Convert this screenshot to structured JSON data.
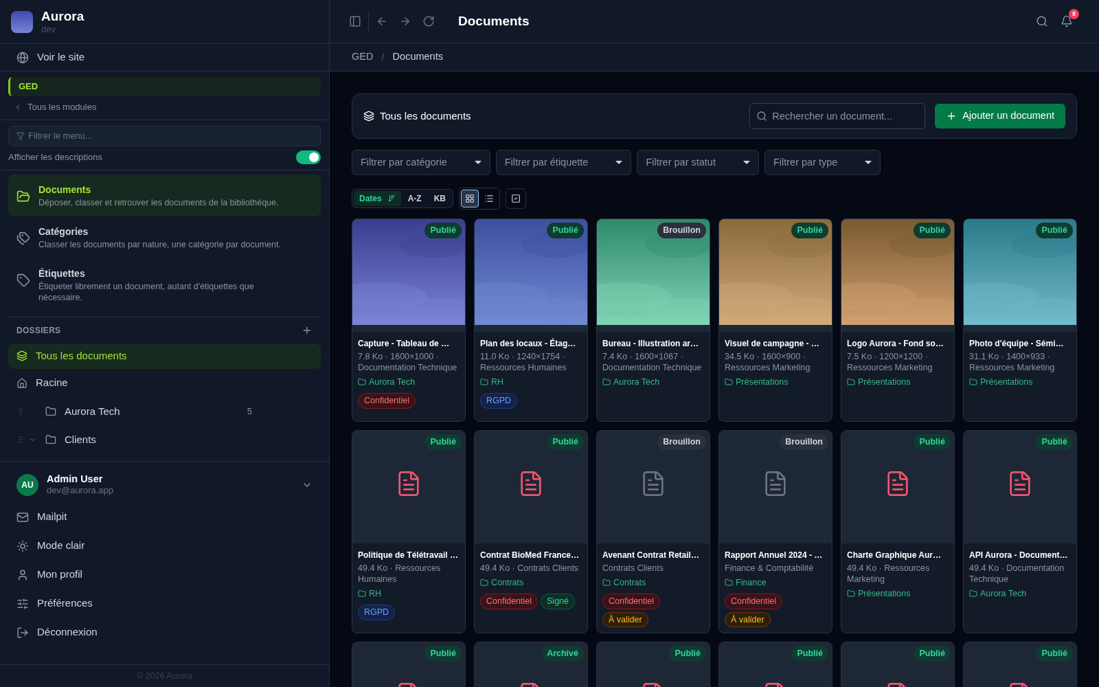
{
  "brand": {
    "name": "Aurora",
    "env": "dev"
  },
  "site_link": "Voir le site",
  "module": {
    "name": "GED",
    "back": "Tous les modules"
  },
  "menu_filter": {
    "placeholder": "Filtrer le menu..."
  },
  "descriptions_toggle": {
    "label": "Afficher les descriptions",
    "on": true
  },
  "nav": [
    {
      "kind": "documents",
      "label": "Documents",
      "description": "Déposer, classer et retrouver les documents de la bibliothèque.",
      "selected": true
    },
    {
      "kind": "categories",
      "label": "Catégories",
      "description": "Classer les documents par nature, une catégorie par document.",
      "selected": false
    },
    {
      "kind": "tags",
      "label": "Étiquettes",
      "description": "Étiqueter librement un document, autant d'étiquettes que nécessaire.",
      "selected": false
    }
  ],
  "folders": {
    "heading": "DOSSIERS",
    "all": {
      "label": "Tous les documents",
      "selected": true
    },
    "root": {
      "label": "Racine",
      "children": [
        {
          "label": "Aurora Tech",
          "count": "5"
        },
        {
          "label": "Clients",
          "expanded": true
        }
      ]
    }
  },
  "user": {
    "initials": "AU",
    "name": "Admin User",
    "email": "dev@aurora.app"
  },
  "user_menu": [
    {
      "kind": "mail",
      "label": "Mailpit"
    },
    {
      "kind": "theme",
      "label": "Mode clair"
    },
    {
      "kind": "profile",
      "label": "Mon profil"
    },
    {
      "kind": "prefs",
      "label": "Préférences"
    },
    {
      "kind": "logout",
      "label": "Déconnexion"
    }
  ],
  "footer": "© 2026 Aurora",
  "page_title": "Documents",
  "notifications": "8",
  "breadcrumb": {
    "items": [
      "GED",
      "Documents"
    ],
    "separator": "/"
  },
  "toolbar": {
    "title": "Tous les documents",
    "search_placeholder": "Rechercher un document...",
    "add_button": "Ajouter un document"
  },
  "filters": [
    "Filtrer par catégorie",
    "Filtrer par étiquette",
    "Filtrer par statut",
    "Filtrer par type"
  ],
  "sort": [
    {
      "label": "Dates",
      "selected": true
    },
    {
      "label": "A-Z",
      "selected": false
    },
    {
      "label": "KB",
      "selected": false
    }
  ],
  "views": [
    {
      "kind": "grid",
      "selected": true
    },
    {
      "kind": "list",
      "selected": false
    }
  ],
  "cards": [
    {
      "status": {
        "label": "Publié",
        "kind": "published"
      },
      "title": "Capture - Tableau de …",
      "meta": "7.8 Ko · 1600×1000 · Documentation Technique",
      "folder": "Aurora Tech",
      "tags": [
        {
          "label": "Confidentiel",
          "kind": "danger"
        }
      ]
    },
    {
      "status": {
        "label": "Publié",
        "kind": "published"
      },
      "title": "Plan des locaux - Étag…",
      "meta": "11.0 Ko · 1240×1754 · Ressources Humaines",
      "folder": "RH",
      "tags": [
        {
          "label": "RGPD",
          "kind": "info"
        }
      ]
    },
    {
      "status": {
        "label": "Brouillon",
        "kind": "draft"
      },
      "title": "Bureau - Illustration ar…",
      "meta": "7.4 Ko · 1600×1067 · Documentation Technique",
      "folder": "Aurora Tech"
    },
    {
      "status": {
        "label": "Publié",
        "kind": "published"
      },
      "title": "Visuel de campagne - …",
      "meta": "34.5 Ko · 1600×900 · Ressources Marketing",
      "folder": "Présentations"
    },
    {
      "status": {
        "label": "Publié",
        "kind": "published"
      },
      "title": "Logo Aurora - Fond so…",
      "meta": "7.5 Ko · 1200×1200 · Ressources Marketing",
      "folder": "Présentations"
    },
    {
      "status": {
        "label": "Publié",
        "kind": "published"
      },
      "title": "Photo d'équipe - Sémi…",
      "meta": "31.1 Ko · 1400×933 · Ressources Marketing",
      "folder": "Présentations"
    },
    {
      "kind": "file",
      "status": {
        "label": "Publié",
        "kind": "published"
      },
      "title": "Politique de Télétravail …",
      "meta": "49.4 Ko · Ressources Humaines",
      "folder": "RH",
      "tags": [
        {
          "label": "RGPD",
          "kind": "info"
        }
      ]
    },
    {
      "kind": "file",
      "status": {
        "label": "Publié",
        "kind": "published"
      },
      "title": "Contrat BioMed France…",
      "meta": "49.4 Ko · Contrats Clients",
      "folder": "Contrats",
      "tags": [
        {
          "label": "Confidentiel",
          "kind": "danger"
        },
        {
          "label": "Signé",
          "kind": "success"
        }
      ]
    },
    {
      "kind": "file",
      "status": {
        "label": "Brouillon",
        "kind": "draft"
      },
      "title": "Avenant Contrat Retail…",
      "meta": "Contrats Clients",
      "folder": "Contrats",
      "tags": [
        {
          "label": "Confidentiel",
          "kind": "danger"
        },
        {
          "label": "À valider",
          "kind": "warning"
        }
      ]
    },
    {
      "kind": "file",
      "status": {
        "label": "Brouillon",
        "kind": "draft"
      },
      "title": "Rapport Annuel 2024 - …",
      "meta": "Finance & Comptabilité",
      "folder": "Finance",
      "tags": [
        {
          "label": "Confidentiel",
          "kind": "danger"
        },
        {
          "label": "À valider",
          "kind": "warning"
        }
      ]
    },
    {
      "kind": "file",
      "status": {
        "label": "Publié",
        "kind": "published"
      },
      "title": "Charte Graphique Aur…",
      "meta": "49.4 Ko · Ressources Marketing",
      "folder": "Présentations"
    },
    {
      "kind": "file",
      "status": {
        "label": "Publié",
        "kind": "published"
      },
      "title": "API Aurora - Document…",
      "meta": "49.4 Ko · Documentation Technique",
      "folder": "Aurora Tech"
    },
    {
      "kind": "file",
      "status": {
        "label": "Publié",
        "kind": "published"
      }
    },
    {
      "kind": "file",
      "status": {
        "label": "Archivé",
        "kind": "archived"
      }
    },
    {
      "kind": "file",
      "status": {
        "label": "Publié",
        "kind": "published"
      }
    },
    {
      "kind": "file",
      "status": {
        "label": "Publié",
        "kind": "published"
      }
    },
    {
      "kind": "file",
      "status": {
        "label": "Publié",
        "kind": "published"
      }
    },
    {
      "kind": "file",
      "status": {
        "label": "Publié",
        "kind": "published"
      }
    }
  ]
}
